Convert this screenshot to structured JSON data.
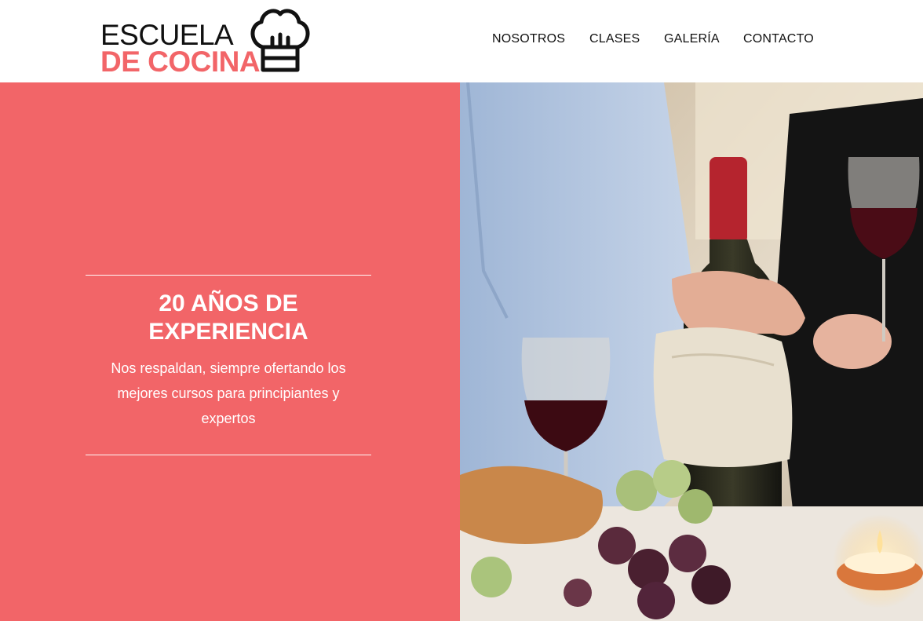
{
  "brand": {
    "line1": "ESCUELA",
    "line2": "DE COCINA",
    "accent_color": "#f26568",
    "hat_icon": "chef-hat-icon"
  },
  "nav": {
    "items": [
      {
        "label": "NOSOTROS"
      },
      {
        "label": "CLASES"
      },
      {
        "label": "GALERÍA"
      },
      {
        "label": "CONTACTO"
      }
    ]
  },
  "hero": {
    "background_color": "#f26568",
    "title_line1": "20 AÑOS DE",
    "title_line2": "EXPERIENCIA",
    "description": "Nos respaldan, siempre ofertando los mejores cursos para principiantes y expertos",
    "image_subject": "wine-dinner-photo"
  }
}
